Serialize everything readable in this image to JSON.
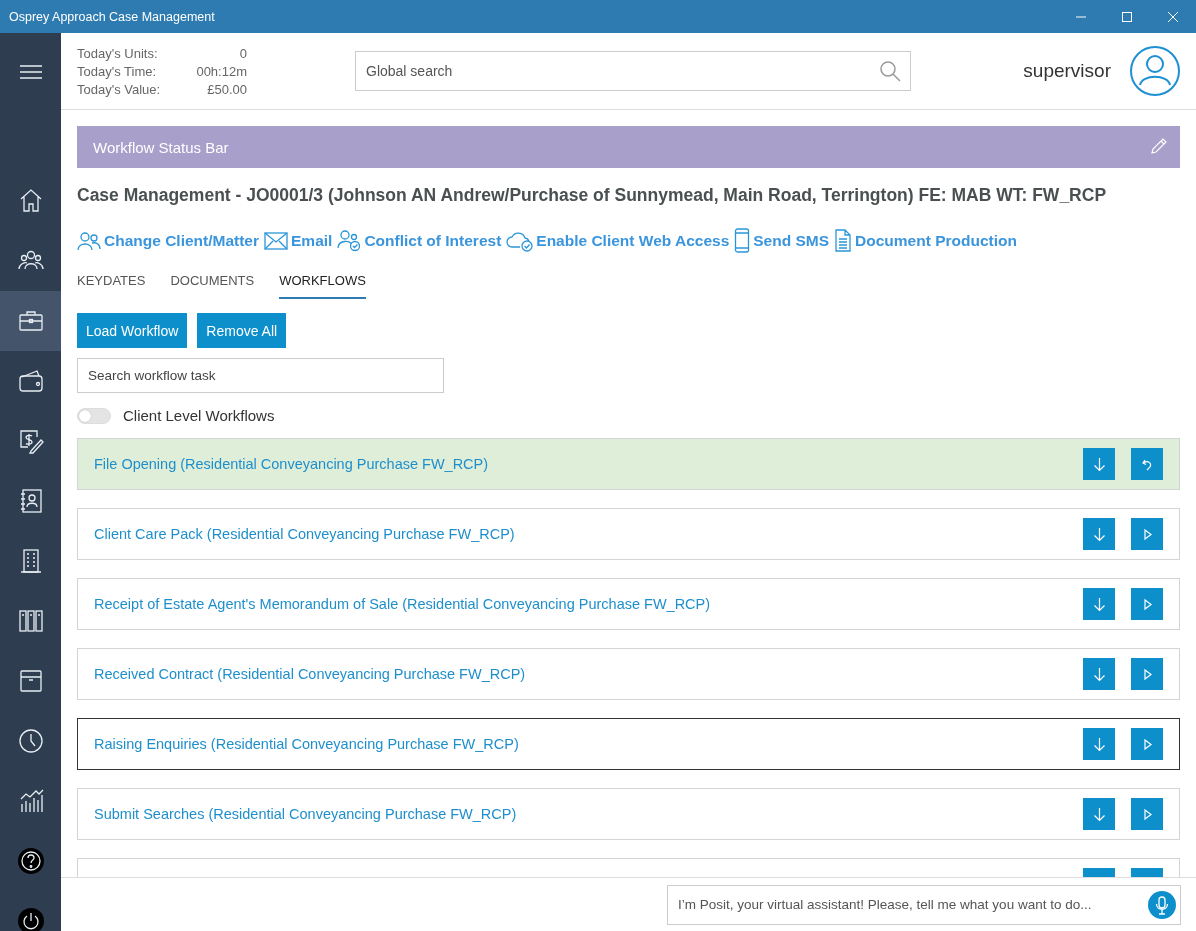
{
  "window": {
    "title": "Osprey Approach Case Management"
  },
  "sidebar": {
    "items": [
      {
        "selected": false
      },
      {
        "selected": false
      },
      {
        "selected": true
      },
      {
        "selected": false
      },
      {
        "selected": false
      },
      {
        "selected": false
      },
      {
        "selected": false
      },
      {
        "selected": false
      },
      {
        "selected": false
      },
      {
        "selected": false
      },
      {
        "selected": false
      },
      {
        "selected": false
      },
      {
        "selected": false
      }
    ]
  },
  "stats": [
    {
      "label": "Today's Units:",
      "value": "0"
    },
    {
      "label": "Today's Time:",
      "value": "00h:12m"
    },
    {
      "label": "Today's Value:",
      "value": "£50.00"
    }
  ],
  "search": {
    "placeholder": "Global search"
  },
  "user": {
    "name": "supervisor"
  },
  "status_bar": {
    "title": "Workflow Status Bar"
  },
  "case_title": "Case Management - JO0001/3 (Johnson AN Andrew/Purchase of Sunnymead, Main Road, Terrington) FE: MAB WT: FW_RCP",
  "actions": [
    {
      "label": "Change Client/Matter"
    },
    {
      "label": "Email"
    },
    {
      "label": "Conflict of Interest"
    },
    {
      "label": "Enable Client Web Access"
    },
    {
      "label": "Send SMS"
    },
    {
      "label": "Document Production"
    }
  ],
  "tabs": [
    {
      "label": "KEYDATES",
      "selected": false
    },
    {
      "label": "DOCUMENTS",
      "selected": false
    },
    {
      "label": "WORKFLOWS",
      "selected": true
    }
  ],
  "buttons": [
    "Load Workflow",
    "Remove All"
  ],
  "task_search": {
    "placeholder": "Search workflow task"
  },
  "client_level_toggle": {
    "label": "Client Level Workflows",
    "on": false
  },
  "workflows": [
    {
      "name": "File Opening (Residential Conveyancing Purchase FW_RCP)",
      "kind": "completed",
      "highlighted": false
    },
    {
      "name": "Client Care Pack (Residential Conveyancing Purchase FW_RCP)",
      "kind": "pending",
      "highlighted": false
    },
    {
      "name": "Receipt of Estate Agent's Memorandum of Sale (Residential Conveyancing Purchase FW_RCP)",
      "kind": "pending",
      "highlighted": false
    },
    {
      "name": "Received Contract (Residential Conveyancing Purchase FW_RCP)",
      "kind": "pending",
      "highlighted": false
    },
    {
      "name": "Raising Enquiries (Residential Conveyancing Purchase FW_RCP)",
      "kind": "pending",
      "highlighted": true
    },
    {
      "name": "Submit Searches (Residential Conveyancing Purchase FW_RCP)",
      "kind": "pending",
      "highlighted": false
    },
    {
      "kind": "pending",
      "highlighted": false
    }
  ],
  "assistant": {
    "placeholder": "I’m Posit, your virtual assistant! Please, tell me what you want to do..."
  }
}
